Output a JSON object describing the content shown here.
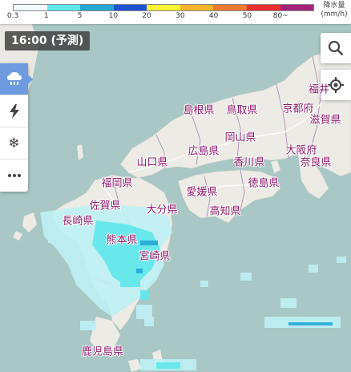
{
  "legend": {
    "ticks": [
      "0.3",
      "1",
      "5",
      "10",
      "20",
      "30",
      "40",
      "50",
      "80~"
    ],
    "colors": [
      "#f2fdfd",
      "#60e8ec",
      "#26a9d8",
      "#1d53d1",
      "#f9f533",
      "#f5b42c",
      "#f07932",
      "#e9302e",
      "#a5207a"
    ],
    "unit_line1": "降水量",
    "unit_line2": "(mm/h)"
  },
  "time_badge": "16:00 (予測)",
  "side_menu": [
    {
      "name": "rain-cloud-icon",
      "active": true
    },
    {
      "name": "lightning-icon",
      "active": false
    },
    {
      "name": "snowflake-icon",
      "active": false
    },
    {
      "name": "more-icon",
      "active": false
    }
  ],
  "prefectures": {
    "shimane": "島根県",
    "tottori": "鳥取県",
    "kyoto": "京都府",
    "fukui": "福井",
    "shiga": "滋賀県",
    "okayama": "岡山県",
    "hiroshima": "広島県",
    "osaka": "大阪府",
    "yamaguchi": "山口県",
    "kagawa": "香川県",
    "nara": "奈良県",
    "fukuoka": "福岡県",
    "ehime": "愛媛県",
    "tokushima": "徳島県",
    "saga": "佐賀県",
    "oita": "大分県",
    "kochi": "高知県",
    "nagasaki": "長崎県",
    "kumamoto": "熊本県",
    "miyazaki": "宮崎県",
    "kagoshima": "鹿児島県"
  }
}
